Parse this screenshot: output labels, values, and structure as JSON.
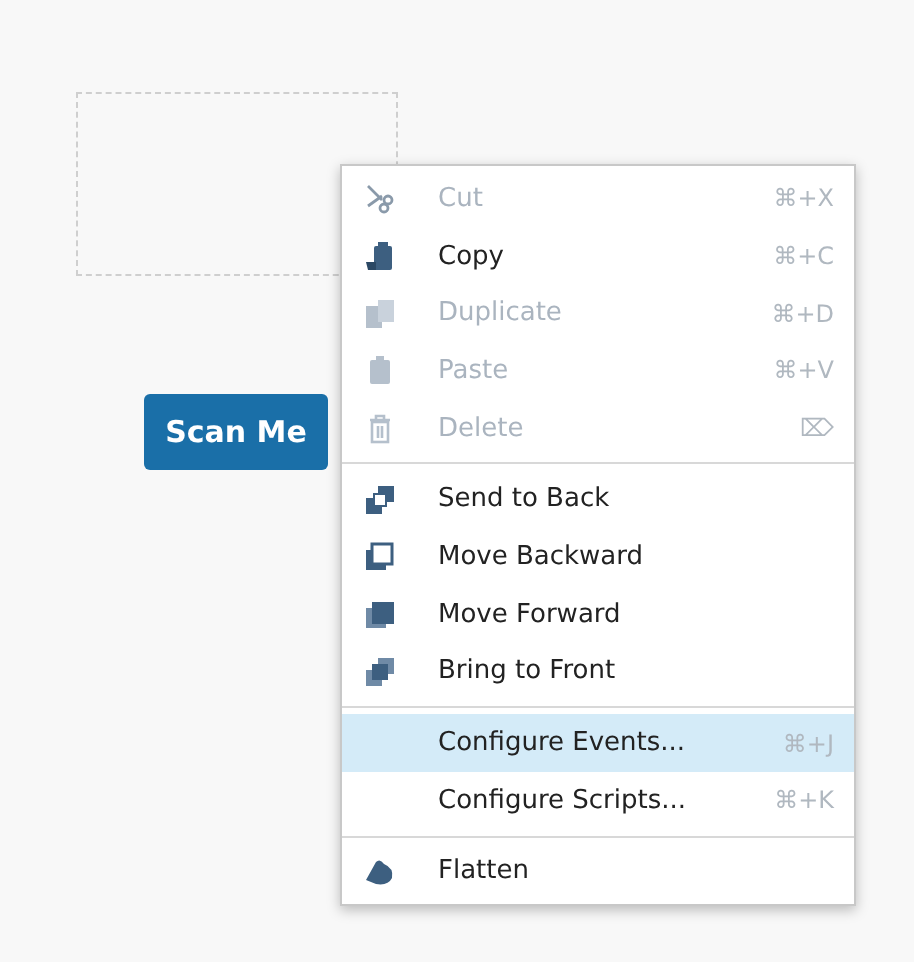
{
  "canvas": {
    "button": "Scan Me"
  },
  "context_menu": {
    "groups": [
      {
        "items": [
          {
            "label": "Cut",
            "shortcut": "⌘+X",
            "disabled": true,
            "selected": false
          },
          {
            "label": "Copy",
            "shortcut": "⌘+C",
            "disabled": false,
            "selected": false
          },
          {
            "label": "Duplicate",
            "shortcut": "⌘+D",
            "disabled": true,
            "selected": false
          },
          {
            "label": "Paste",
            "shortcut": "⌘+V",
            "disabled": true,
            "selected": false
          },
          {
            "label": "Delete",
            "shortcut": "⌦",
            "disabled": true,
            "selected": false
          }
        ]
      },
      {
        "items": [
          {
            "label": "Send to Back",
            "disabled": false,
            "selected": false
          },
          {
            "label": "Move Backward",
            "disabled": false,
            "selected": false
          },
          {
            "label": "Move Forward",
            "disabled": false,
            "selected": false
          },
          {
            "label": "Bring to Front",
            "disabled": false,
            "selected": false
          }
        ]
      },
      {
        "items": [
          {
            "label": "Configure Events...",
            "shortcut": "⌘+J",
            "disabled": false,
            "selected": true
          },
          {
            "label": "Configure Scripts...",
            "shortcut": "⌘+K",
            "disabled": false,
            "selected": false
          }
        ]
      },
      {
        "items": [
          {
            "label": "Flatten",
            "disabled": false,
            "selected": false
          }
        ]
      }
    ]
  }
}
